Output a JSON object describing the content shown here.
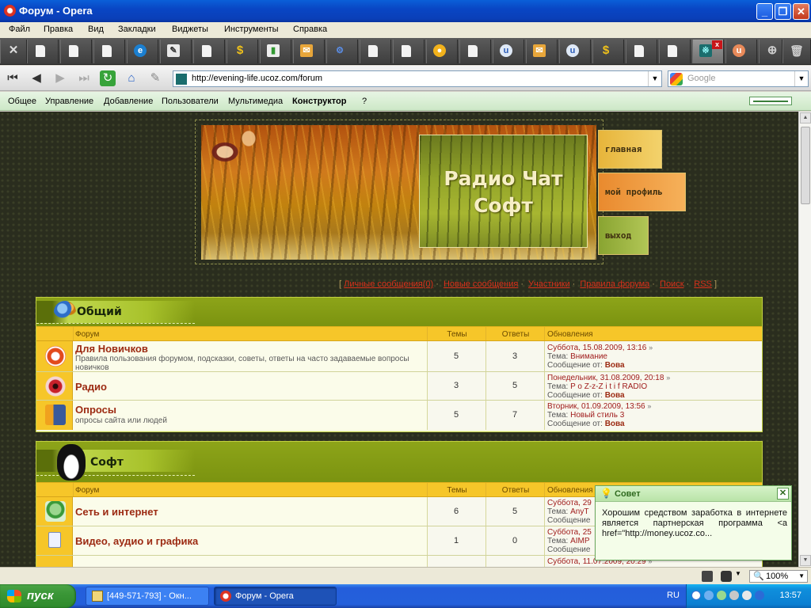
{
  "window": {
    "title": "Форум - Opera"
  },
  "menu": [
    "Файл",
    "Правка",
    "Вид",
    "Закладки",
    "Виджеты",
    "Инструменты",
    "Справка"
  ],
  "address": {
    "url": "http://evening-life.ucoz.com/forum",
    "search_placeholder": "Google"
  },
  "ucoz_bar": {
    "items": [
      "Общее",
      "Управление",
      "Добавление",
      "Пользователи",
      "Мультимедиа",
      "Конструктор",
      "?"
    ]
  },
  "banner": {
    "title_line1": "Радио Чат",
    "title_line2": "Софт",
    "nav": [
      "главная",
      "мой профиль",
      "выход"
    ]
  },
  "forum_links": {
    "open": "[",
    "close": "]",
    "items": [
      "Личные сообщения(0)",
      "Новые сообщения",
      "Участники",
      "Правила форума",
      "Поиск",
      "RSS"
    ]
  },
  "columns": {
    "forum": "Форум",
    "topics": "Темы",
    "replies": "Ответы",
    "updates": "Обновления"
  },
  "categories": [
    {
      "title": "Общий",
      "forums": [
        {
          "name": "Для Новичков",
          "desc": "Правила пользования форумом, подсказки, советы, ответы на часто задаваемые вопросы новичков",
          "topics": "5",
          "replies": "3",
          "date": "Суббота, 15.08.2009, 13:16",
          "topic_label": "Тема:",
          "topic": "Внимание",
          "msg_label": "Сообщение от:",
          "author": "Вова"
        },
        {
          "name": "Радио",
          "desc": "",
          "topics": "3",
          "replies": "5",
          "date": "Понедельник, 31.08.2009, 20:18",
          "topic_label": "Тема:",
          "topic": "P o Z-z-Z i t i f RADIO",
          "msg_label": "Сообщение от:",
          "author": "Вова"
        },
        {
          "name": "Опросы",
          "desc": "опросы сайта или людей",
          "topics": "5",
          "replies": "7",
          "date": "Вторник, 01.09.2009, 13:56",
          "topic_label": "Тема:",
          "topic": "Новый стиль 3",
          "msg_label": "Сообщение от:",
          "author": "Вова"
        }
      ]
    },
    {
      "title": "Софт",
      "forums": [
        {
          "name": "Сеть и интернет",
          "desc": "",
          "topics": "6",
          "replies": "5",
          "date": "Суббота, 29",
          "topic_label": "Тема:",
          "topic": "AnyT",
          "msg_label": "Сообщение",
          "author": ""
        },
        {
          "name": "Видео, аудио и графика",
          "desc": "",
          "topics": "1",
          "replies": "0",
          "date": "Суббота, 25",
          "topic_label": "Тема:",
          "topic": "AIMP",
          "msg_label": "Сообщение",
          "author": ""
        },
        {
          "name": "",
          "desc": "",
          "topics": "",
          "replies": "",
          "date": "Суббота, 11.07.2009, 20:29",
          "topic_label": "",
          "topic": "",
          "msg_label": "",
          "author": ""
        }
      ]
    }
  ],
  "tip": {
    "title": "Совет",
    "text": "Хорошим средством заработка в интернете является партнерская программа <a href=\"http://money.ucoz.co..."
  },
  "statusbar": {
    "zoom": "100%"
  },
  "taskbar": {
    "start": "пуск",
    "tasks": [
      "[449-571-793] - Окн...",
      "Форум - Opera"
    ],
    "lang": "RU",
    "clock": "13:57"
  }
}
